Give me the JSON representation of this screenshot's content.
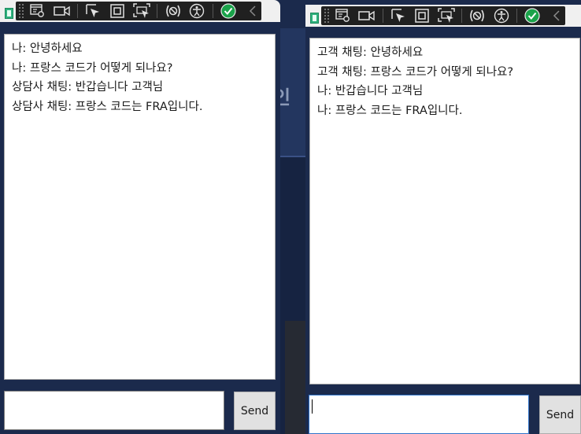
{
  "background": {
    "glyph": "인"
  },
  "agent_window": {
    "messages": [
      "나: 안녕하세요",
      "나: 프랑스 코드가 어떻게 되나요?",
      "상담사 채팅: 반갑습니다 고객님",
      "상담사 채팅: 프랑스 코드는 FRA입니다."
    ],
    "input_value": "",
    "send_label": "Send"
  },
  "customer_window": {
    "messages": [
      "고객 채팅: 안녕하세요",
      "고객 채팅: 프랑스 코드가 어떻게 되나요?",
      "나: 반갑습니다 고객님",
      "나: 프랑스 코드는 FRA입니다."
    ],
    "input_value": "",
    "send_label": "Send"
  },
  "toolbar_icons": [
    "live-visual-tree-icon",
    "select-element-icon",
    "video-icon",
    "select-pointer-icon",
    "display-adorners-icon",
    "track-focus-icon",
    "binding-failures-icon",
    "accessibility-icon",
    "checkmark-icon",
    "collapse-chevron-icon"
  ],
  "colors": {
    "desktop": "#1b2a4c",
    "toolbar": "#202020",
    "check_green": "#1aa34a",
    "input_focus": "#2f73c9"
  }
}
